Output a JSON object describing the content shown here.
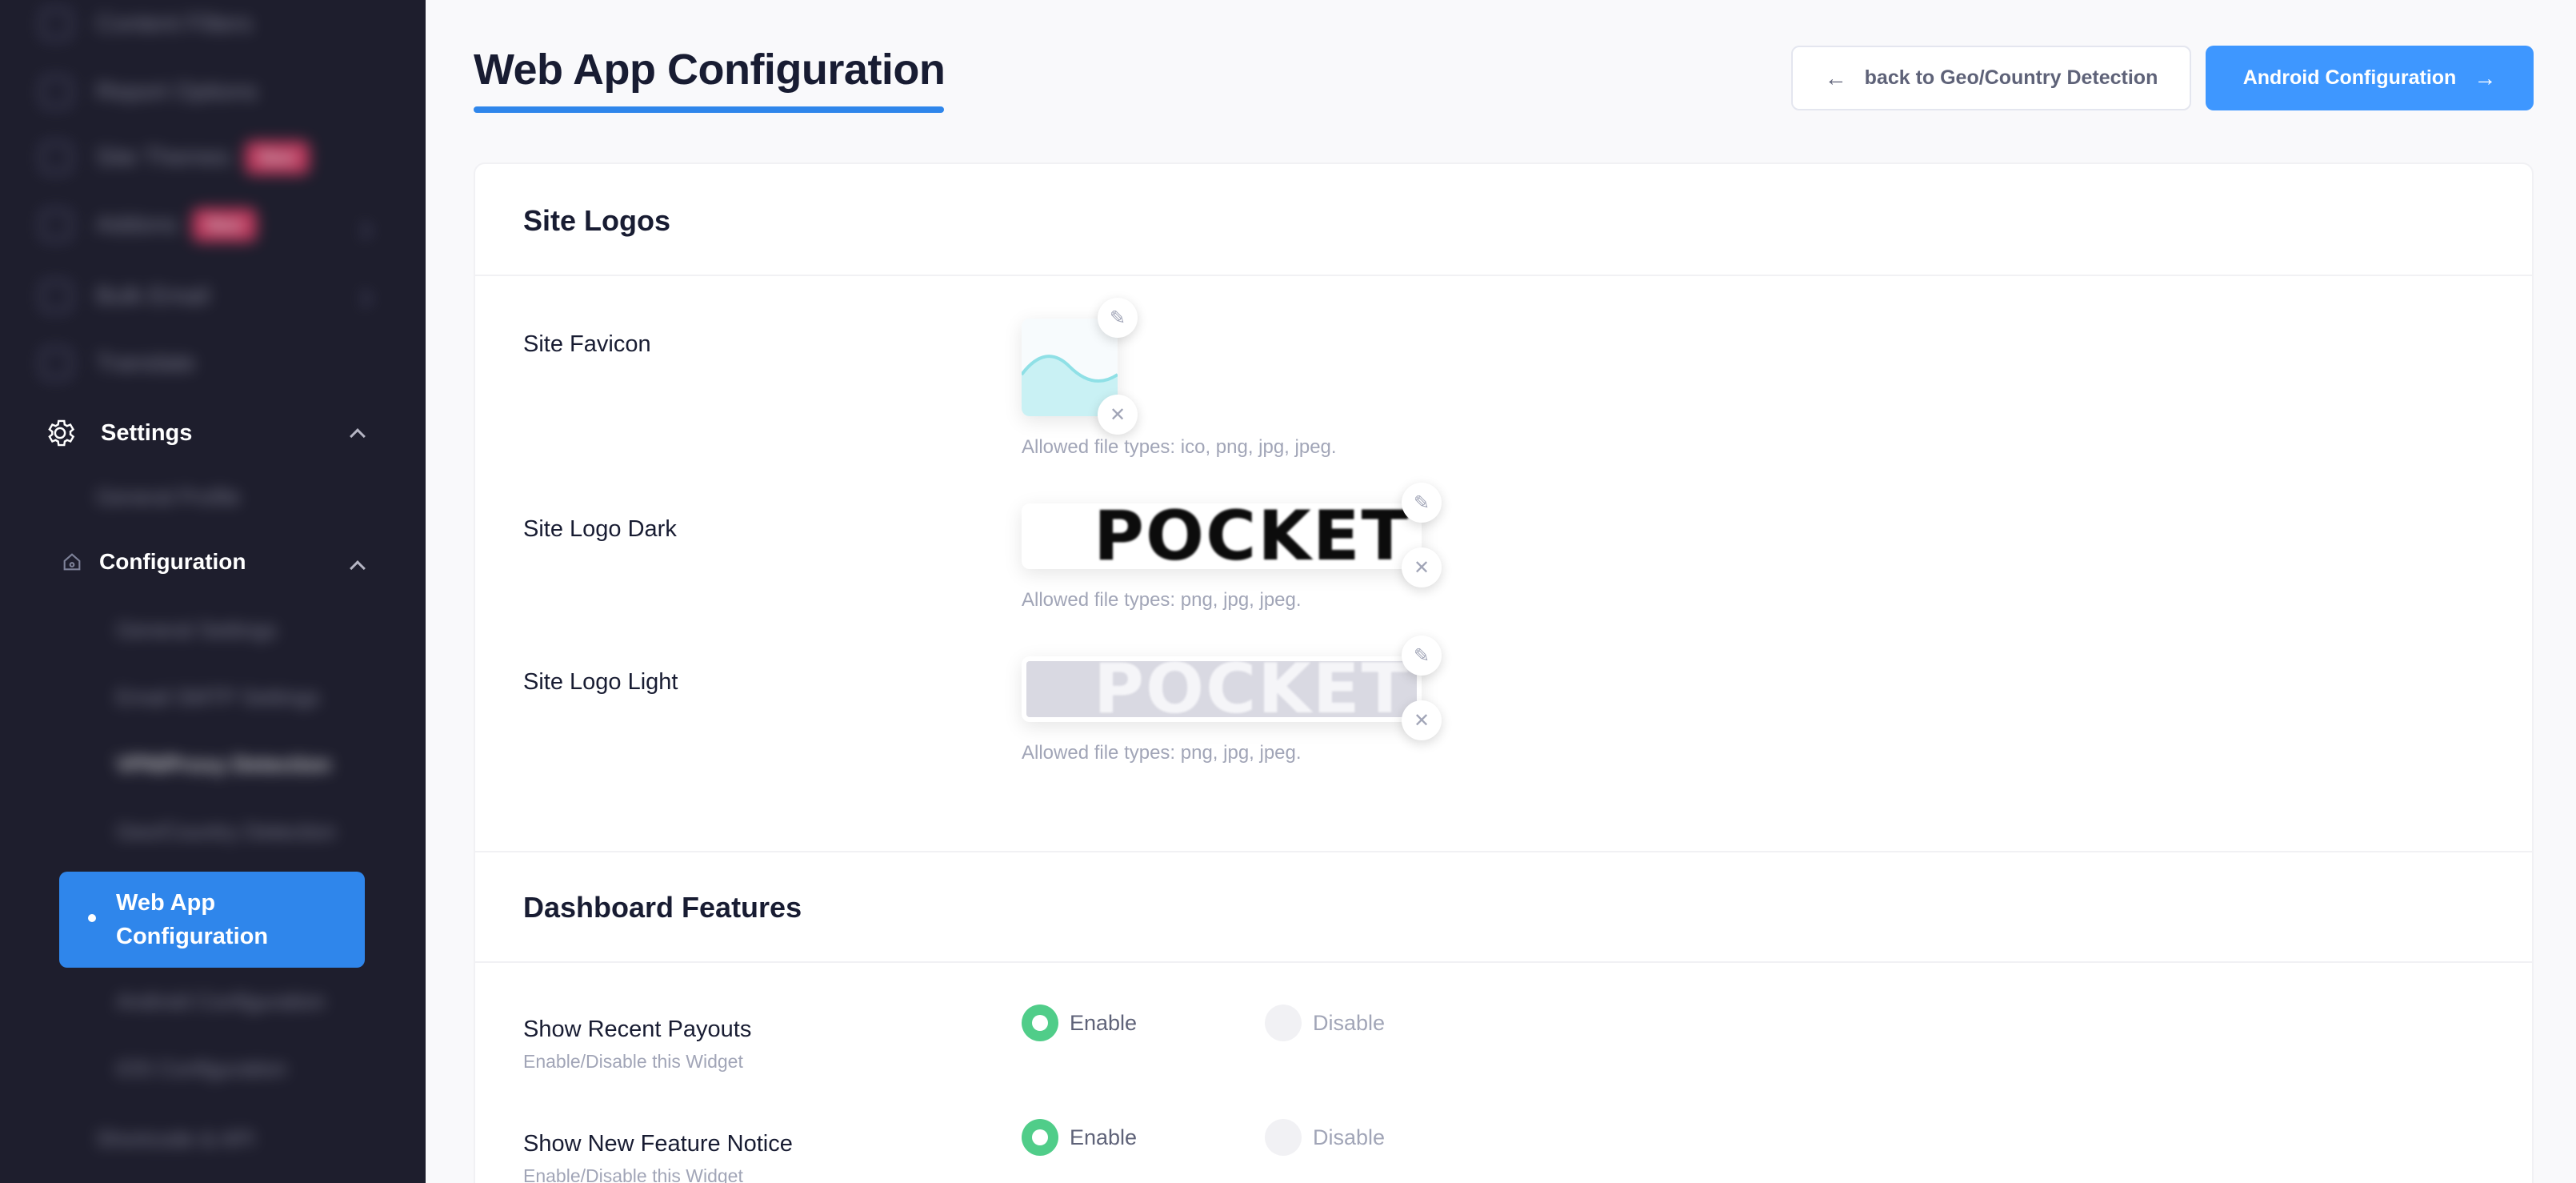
{
  "sidebar": {
    "blurred_items": [
      {
        "label": "Content Filters",
        "badge": ""
      },
      {
        "label": "Report Options",
        "badge": ""
      },
      {
        "label": "Site Themes",
        "badge": "New"
      },
      {
        "label": "Addons",
        "badge": "New"
      },
      {
        "label": "Bulk Email",
        "badge": ""
      },
      {
        "label": "Translate",
        "badge": ""
      }
    ],
    "settings_label": "Settings",
    "blurred_settings_sub": "General Profile",
    "configuration_label": "Configuration",
    "blurred_config_items": [
      "General Settings",
      "Email SMTP Settings",
      "VPN/Proxy Detection",
      "Geo/Country Detection"
    ],
    "active_item": "Web App Configuration",
    "blurred_after": [
      "Android Configuration",
      "iOS Configuration"
    ],
    "blurred_last": "Shortcode & API"
  },
  "header": {
    "title": "Web App Configuration",
    "back_button": "back to Geo/Country Detection",
    "next_button": "Android Configuration"
  },
  "site_logos": {
    "section_title": "Site Logos",
    "favicon": {
      "label": "Site Favicon",
      "hint": "Allowed file types: ico, png, jpg, jpeg."
    },
    "logo_dark": {
      "label": "Site Logo Dark",
      "hint": "Allowed file types: png, jpg, jpeg.",
      "logo_text": "POCKET"
    },
    "logo_light": {
      "label": "Site Logo Light",
      "hint": "Allowed file types: png, jpg, jpeg.",
      "logo_text": "POCKET"
    }
  },
  "dashboard_features": {
    "section_title": "Dashboard Features",
    "rows": [
      {
        "label": "Show Recent Payouts",
        "sub": "Enable/Disable this Widget",
        "enable": "Enable",
        "disable": "Disable",
        "selected": "enable"
      },
      {
        "label": "Show New Feature Notice",
        "sub": "Enable/Disable this Widget",
        "enable": "Enable",
        "disable": "Disable",
        "selected": "enable"
      }
    ]
  },
  "colors": {
    "accent": "#3e97ff",
    "sidebar_bg": "#1e1e2d",
    "radio_on": "#50cd89"
  }
}
